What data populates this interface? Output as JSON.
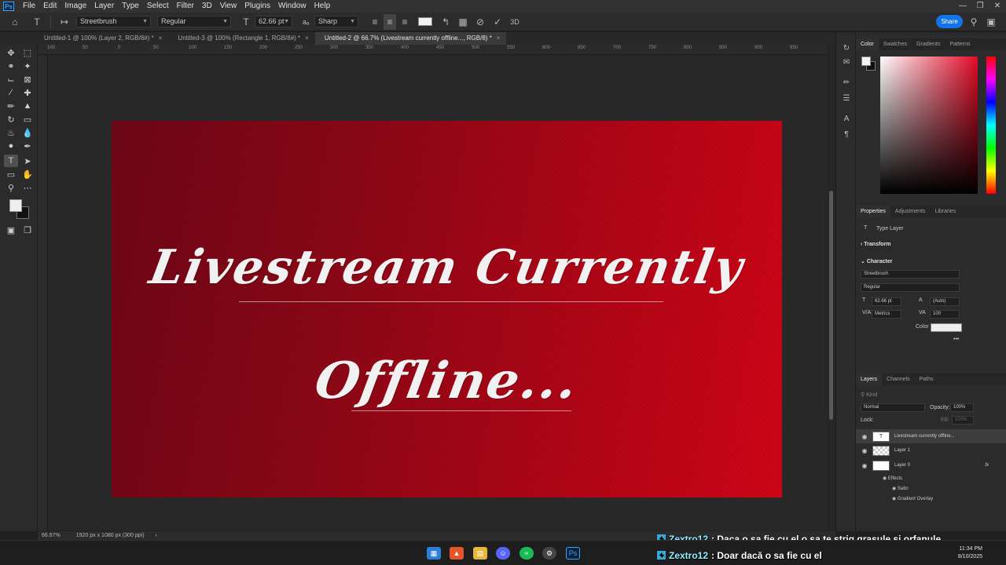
{
  "app": {
    "logo": "Ps"
  },
  "menu": [
    "File",
    "Edit",
    "Image",
    "Layer",
    "Type",
    "Select",
    "Filter",
    "3D",
    "View",
    "Plugins",
    "Window",
    "Help"
  ],
  "options": {
    "font_family": "Streetbrush",
    "font_style": "Regular",
    "font_size": "62.66 pt",
    "aa_label": "aₐ",
    "anti_alias": "Sharp",
    "share": "Share"
  },
  "tabs": [
    {
      "label": "Untitled-1 @ 100% (Layer 2, RGB/8#) *",
      "close": "×"
    },
    {
      "label": "Untitled-3 @ 100% (Rectangle 1, RGB/8#) *",
      "close": "×"
    },
    {
      "label": "Untitled-2 @ 66.7% (Livestream currently  offline..., RGB/8) *",
      "close": "×"
    }
  ],
  "ruler": [
    "100",
    "50",
    "0",
    "50",
    "100",
    "150",
    "200",
    "250",
    "300",
    "350",
    "400",
    "450",
    "500",
    "550",
    "600",
    "650",
    "700",
    "750",
    "800",
    "850",
    "900",
    "950"
  ],
  "canvas": {
    "line1": "Livestream Currently",
    "line2": "Offline..."
  },
  "status": {
    "zoom": "66.67%",
    "doc_info": "1920 px x 1080 px (300 ppi)"
  },
  "color_panel": {
    "tabs": [
      "Color",
      "Swatches",
      "Gradients",
      "Patterns"
    ],
    "accent": "#e20a26"
  },
  "properties": {
    "tabs": [
      "Properties",
      "Adjustments",
      "Libraries"
    ],
    "layer_type": "Type Layer",
    "transform": "Transform",
    "character": "Character",
    "font_family": "Streetbrush",
    "font_style": "Regular",
    "size": "62.66 pt",
    "leading": "(Auto)",
    "kerning": "Metrics",
    "tracking": "100",
    "color_label": "Color",
    "more": "•••"
  },
  "layers": {
    "tabs": [
      "Layers",
      "Channels",
      "Paths"
    ],
    "kind": "Kind",
    "blend_mode": "Normal",
    "opacity_label": "Opacity:",
    "opacity": "100%",
    "lock_label": "Lock:",
    "fill_label": "Fill:",
    "fill": "100%",
    "rows": [
      {
        "name": "Livestream currently  offline...",
        "thumb": "T"
      },
      {
        "name": "Layer 1",
        "thumb": ""
      },
      {
        "name": "Layer 0",
        "thumb": "",
        "fx": "fx"
      }
    ],
    "effects_label": "Effects",
    "effects": [
      "Satin",
      "Gradient Overlay"
    ]
  },
  "chat": [
    {
      "user": "Zextro12",
      "message": ": Daca o sa fie cu el o sa te strig grasule și orfanule"
    },
    {
      "user": "Zextro12",
      "message": ": Doar dacă o sa fie cu el"
    }
  ],
  "clock": {
    "time": "11:34 PM",
    "date": "8/10/2025"
  }
}
